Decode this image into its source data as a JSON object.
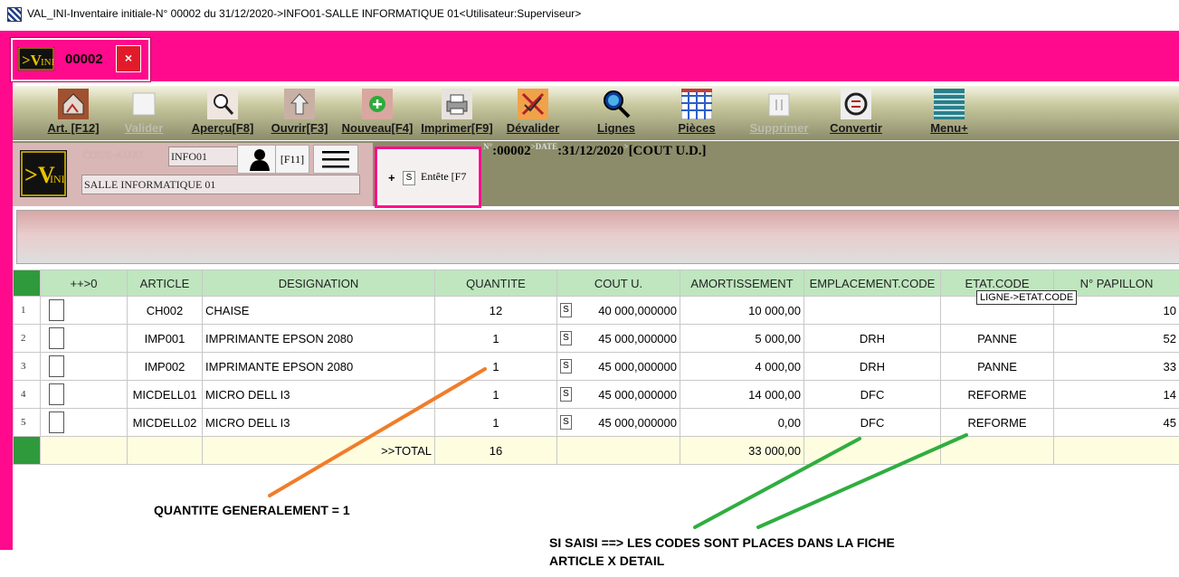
{
  "window": {
    "title": "VAL_INI-Inventaire initiale-N° 00002 du 31/12/2020->INFO01-SALLE INFORMATIQUE 01<Utilisateur:Superviseur>"
  },
  "doc_tab": {
    "logo_text": "VINI",
    "number": "00002",
    "close_glyph": "×"
  },
  "toolbar": {
    "buttons": [
      {
        "label": "Art. [F12]",
        "icon": "house-icon",
        "enabled": true
      },
      {
        "label": "Valider",
        "icon": "validate-icon",
        "enabled": false
      },
      {
        "label": "Aperçu[F8]",
        "icon": "preview-icon",
        "enabled": true
      },
      {
        "label": "Ouvrir[F3]",
        "icon": "open-icon",
        "enabled": true
      },
      {
        "label": "Nouveau[F4]",
        "icon": "new-icon",
        "enabled": true
      },
      {
        "label": "Imprimer[F9]",
        "icon": "printer-icon",
        "enabled": true
      },
      {
        "label": "Dévalider",
        "icon": "unvalidate-icon",
        "enabled": true
      },
      {
        "label": "Lignes",
        "icon": "magnifier-icon",
        "enabled": true
      },
      {
        "label": "Pièces",
        "icon": "pieces-icon",
        "enabled": true
      },
      {
        "label": "Supprimer",
        "icon": "delete-icon",
        "enabled": false
      },
      {
        "label": "Convertir",
        "icon": "convert-icon",
        "enabled": true
      },
      {
        "label": "Menu+",
        "icon": "menu-icon",
        "enabled": true
      }
    ]
  },
  "aux": {
    "label": "CODE-AUXI",
    "code_value": "INFO01",
    "f11_label": "[F11]",
    "libelle_value": "SALLE INFORMATIQUE 01"
  },
  "entete": {
    "plus": "+",
    "s": "S",
    "label": "Entête [F7"
  },
  "docinfo": {
    "n_label": "N°",
    "n_sep": ":",
    "n_value": "00002",
    "date_label": ">DATE",
    "date_value": "31/12/2020",
    "cost_prefix": ">",
    "cost_value": "[COUT U.D.]"
  },
  "grid": {
    "columns": [
      "++>0",
      "ARTICLE",
      "DESIGNATION",
      "QUANTITE",
      "COUT U.",
      "AMORTISSEMENT",
      "EMPLACEMENT.CODE",
      "ETAT.CODE",
      "N° PAPILLON"
    ],
    "rows": [
      {
        "n": "1",
        "article": "CH002",
        "designation": "CHAISE",
        "quantite": "12",
        "cout": "40 000,000000",
        "amort": "10 000,00",
        "empl": "",
        "etat": "",
        "papillon": "10"
      },
      {
        "n": "2",
        "article": "IMP001",
        "designation": "IMPRIMANTE EPSON 2080",
        "quantite": "1",
        "cout": "45 000,000000",
        "amort": "5 000,00",
        "empl": "DRH",
        "etat": "PANNE",
        "papillon": "52"
      },
      {
        "n": "3",
        "article": "IMP002",
        "designation": "IMPRIMANTE EPSON 2080",
        "quantite": "1",
        "cout": "45 000,000000",
        "amort": "4 000,00",
        "empl": "DRH",
        "etat": "PANNE",
        "papillon": "33"
      },
      {
        "n": "4",
        "article": "MICDELL01",
        "designation": "MICRO DELL I3",
        "quantite": "1",
        "cout": "45 000,000000",
        "amort": "14 000,00",
        "empl": "DFC",
        "etat": "REFORME",
        "papillon": "14"
      },
      {
        "n": "5",
        "article": "MICDELL02",
        "designation": "MICRO DELL I3",
        "quantite": "1",
        "cout": "45 000,000000",
        "amort": "0,00",
        "empl": "DFC",
        "etat": "REFORME",
        "papillon": "45"
      }
    ],
    "s_badge": "S",
    "total": {
      "label": ">>TOTAL",
      "quantite": "16",
      "amort": "33 000,00"
    }
  },
  "tooltip": "LIGNE->ETAT.CODE",
  "annotations": {
    "quantity_note": "QUANTITE GENERALEMENT = 1",
    "codes_note_line1": "SI SAISI ==> LES CODES SONT PLACES DANS LA FICHE",
    "codes_note_line2": "ARTICLE X DETAIL",
    "orange_color": "#f07d2a",
    "green_color": "#2fae3f"
  },
  "colors": {
    "frame_pink": "#ff0a8c",
    "header_green": "#bfe6bf",
    "total_yellow": "#fffde0"
  }
}
